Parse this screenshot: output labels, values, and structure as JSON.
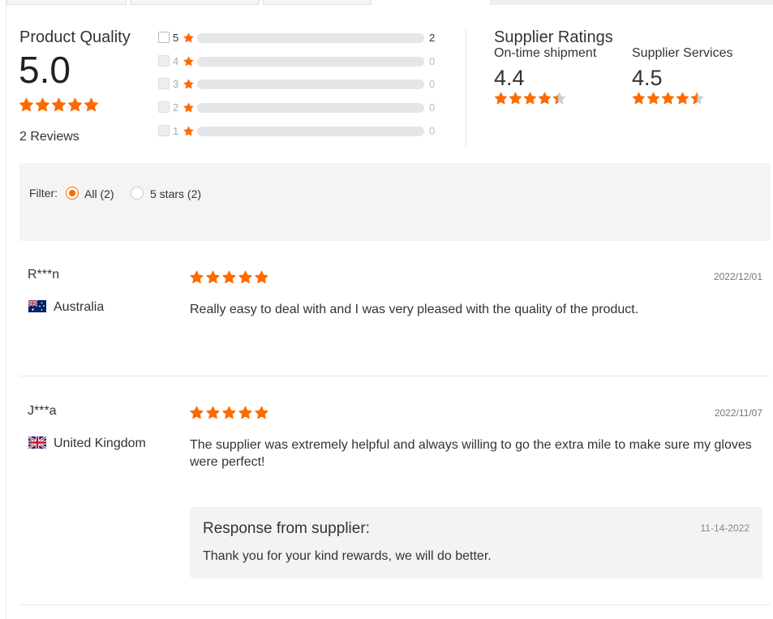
{
  "colors": {
    "accent": "#ff6a00",
    "star_empty": "#cfcfcf",
    "panel_bg": "#f4f4f4"
  },
  "icons": {
    "rating": "star-icon",
    "checkbox": "checkbox-icon",
    "radio": "radio-icon",
    "flags": [
      "flag-australia-icon",
      "flag-united-kingdom-icon"
    ]
  },
  "product_quality": {
    "title": "Product Quality",
    "score": "5.0",
    "stars": 5,
    "reviews_label": "2 Reviews",
    "distribution": [
      {
        "stars": "5",
        "count": "2",
        "fraction": 1.0,
        "enabled": true
      },
      {
        "stars": "4",
        "count": "0",
        "fraction": 0,
        "enabled": false
      },
      {
        "stars": "3",
        "count": "0",
        "fraction": 0,
        "enabled": false
      },
      {
        "stars": "2",
        "count": "0",
        "fraction": 0,
        "enabled": false
      },
      {
        "stars": "1",
        "count": "0",
        "fraction": 0,
        "enabled": false
      }
    ]
  },
  "supplier_ratings": {
    "title": "Supplier Ratings",
    "items": [
      {
        "label": "On-time shipment",
        "score": "4.4",
        "rating": 4.4
      },
      {
        "label": "Supplier Services",
        "score": "4.5",
        "rating": 4.5
      }
    ]
  },
  "filter": {
    "label": "Filter:",
    "options": [
      {
        "label": "All (2)",
        "selected": true
      },
      {
        "label": "5 stars (2)",
        "selected": false
      }
    ]
  },
  "reviews": [
    {
      "name": "R***n",
      "country": "Australia",
      "stars": 5,
      "date": "2022/12/01",
      "text": "Really easy to deal with and I was very pleased with the quality of the product."
    },
    {
      "name": "J***a",
      "country": "United Kingdom",
      "stars": 5,
      "date": "2022/11/07",
      "text": "The supplier was extremely helpful and always willing to go the extra mile to make sure my gloves were perfect!",
      "response": {
        "title": "Response from supplier:",
        "date": "11-14-2022",
        "text": "Thank you for your kind rewards, we will do better."
      }
    }
  ]
}
